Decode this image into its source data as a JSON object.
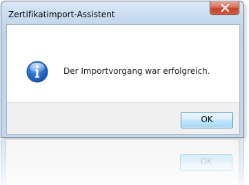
{
  "window": {
    "title": "Zertifikatimport-Assistent",
    "close_icon": "close-icon"
  },
  "dialog": {
    "icon": "info-icon",
    "message": "Der Importvorgang war erfolgreich.",
    "ok_label": "OK"
  },
  "reflection": {
    "ok_label": "OK"
  },
  "colors": {
    "frame": "#c3d7ed",
    "close_button": "#c6462a",
    "info_icon": "#1f63c6",
    "ok_border": "#3c7fb1"
  }
}
